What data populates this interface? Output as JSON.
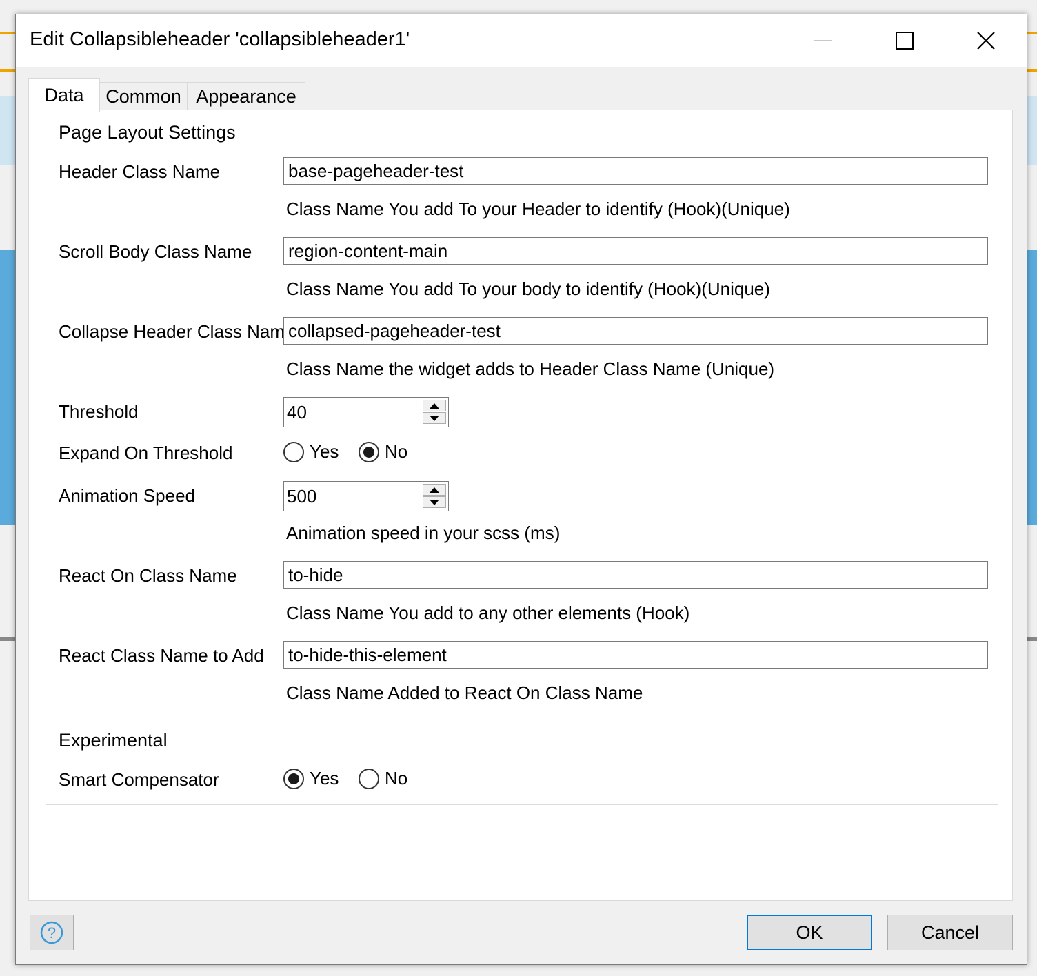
{
  "window": {
    "title": "Edit Collapsibleheader 'collapsibleheader1'"
  },
  "tabs": [
    {
      "label": "Data",
      "active": true
    },
    {
      "label": "Common",
      "active": false
    },
    {
      "label": "Appearance",
      "active": false
    }
  ],
  "page_layout": {
    "title": "Page Layout Settings",
    "header_class": {
      "label": "Header Class Name",
      "value": "base-pageheader-test",
      "hint": "Class Name You add To your Header to identify (Hook)(Unique)"
    },
    "scroll_body": {
      "label": "Scroll Body Class Name",
      "value": "region-content-main",
      "hint": "Class Name You add To your body to identify (Hook)(Unique)"
    },
    "collapse_header": {
      "label": "Collapse Header Class Name",
      "value": "collapsed-pageheader-test",
      "hint": "Class Name the widget adds to Header Class Name (Unique)"
    },
    "threshold": {
      "label": "Threshold",
      "value": "40"
    },
    "expand_on_threshold": {
      "label": "Expand On Threshold",
      "yes": "Yes",
      "no": "No",
      "selected": "No"
    },
    "animation_speed": {
      "label": "Animation Speed",
      "value": "500",
      "hint": "Animation speed in your scss (ms)"
    },
    "react_on_class": {
      "label": "React On Class Name",
      "value": "to-hide",
      "hint": "Class Name You add to any other elements (Hook)"
    },
    "react_class_to_add": {
      "label": "React Class Name to Add",
      "value": "to-hide-this-element",
      "hint": "Class Name Added to React On Class Name"
    }
  },
  "experimental": {
    "title": "Experimental",
    "smart_compensator": {
      "label": "Smart Compensator",
      "yes": "Yes",
      "no": "No",
      "selected": "Yes"
    }
  },
  "footer": {
    "help_icon": "help-circle-icon",
    "ok_label": "OK",
    "cancel_label": "Cancel"
  },
  "colors": {
    "accent": "#0078d7",
    "help_icon": "#3a9ad9"
  }
}
